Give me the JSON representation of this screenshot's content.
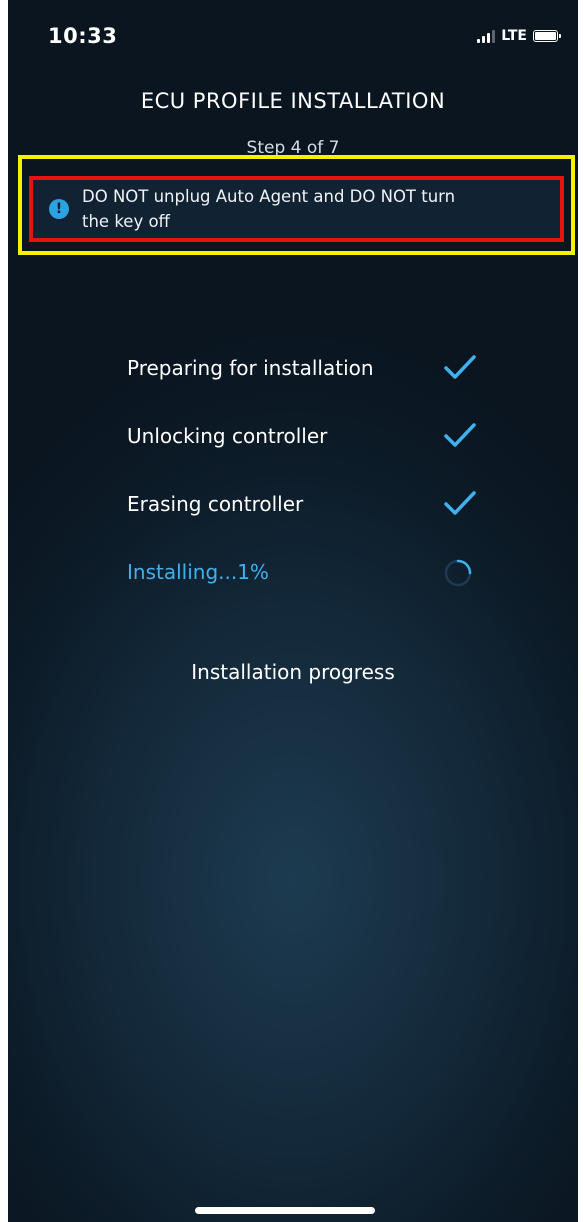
{
  "status_bar": {
    "time": "10:33",
    "network": "LTE",
    "icons": [
      "signal-icon",
      "battery-icon"
    ]
  },
  "header": {
    "title": "ECU PROFILE INSTALLATION",
    "step": "Step 4 of 7"
  },
  "warning": {
    "icon": "exclamation-icon",
    "line1": "DO NOT unplug Auto Agent and DO NOT turn",
    "line2": "the key off"
  },
  "steps": [
    {
      "label": "Preparing for installation",
      "status": "done"
    },
    {
      "label": "Unlocking controller",
      "status": "done"
    },
    {
      "label": "Erasing controller",
      "status": "done"
    },
    {
      "label": "Installing...1%",
      "status": "in_progress"
    }
  ],
  "progress": {
    "label": "Installation progress",
    "percent": 1
  },
  "colors": {
    "accent": "#3fb1ee",
    "highlight_yellow": "#f3f200",
    "highlight_red": "#e8120e",
    "background": "#0d1c29"
  }
}
